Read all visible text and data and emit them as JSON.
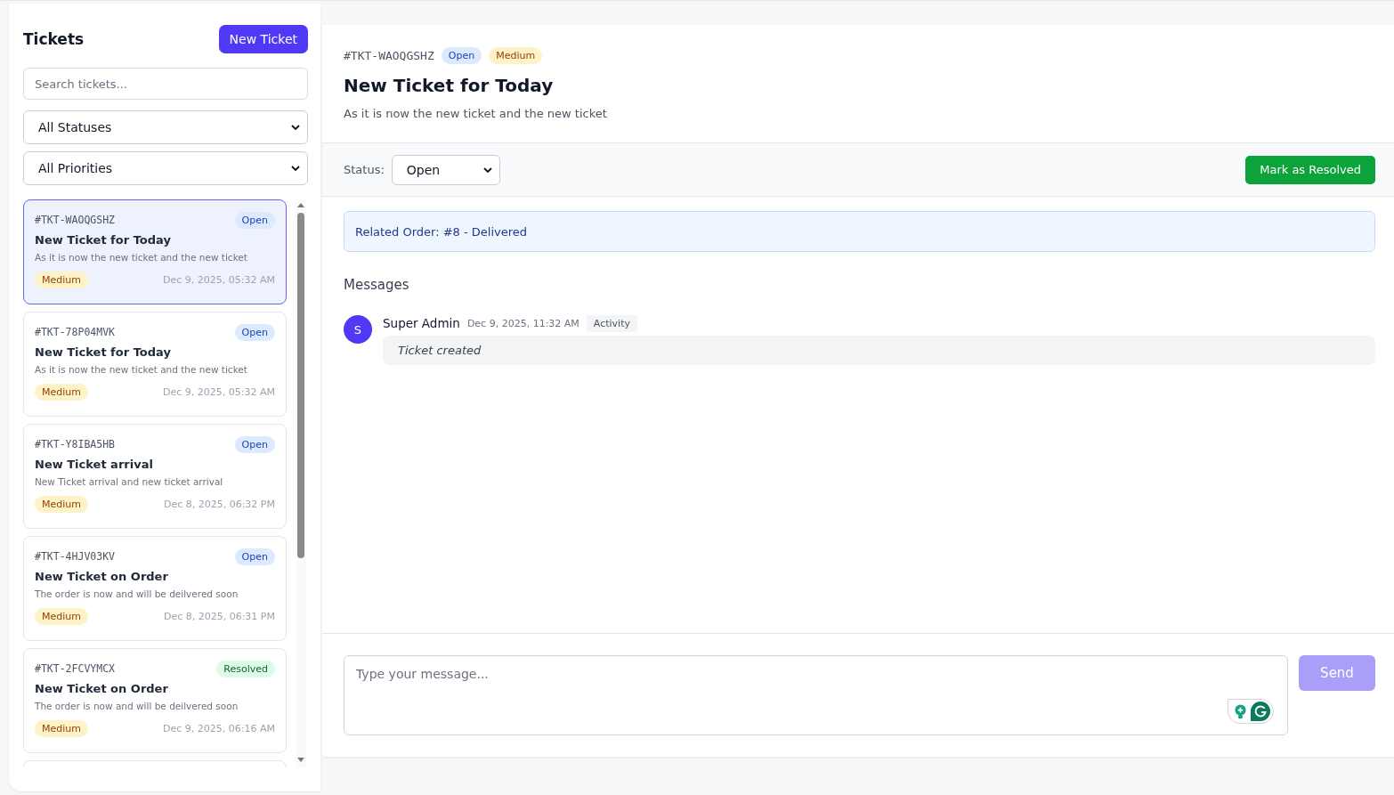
{
  "sidebar": {
    "title": "Tickets",
    "new_button": "New Ticket",
    "search": {
      "placeholder": "Search tickets..."
    },
    "filters": [
      {
        "value": "All Statuses"
      },
      {
        "value": "All Priorities"
      }
    ],
    "tickets": [
      {
        "id": "#TKT-WAOQGSHZ",
        "status": {
          "text": "Open",
          "kind": "open"
        },
        "title": "New Ticket for Today",
        "description": "As it is now the new ticket and the new ticket",
        "priority": "Medium",
        "date": "Dec 9, 2025, 05:32 AM",
        "selected": true
      },
      {
        "id": "#TKT-78P04MVK",
        "status": {
          "text": "Open",
          "kind": "open"
        },
        "title": "New Ticket for Today",
        "description": "As it is now the new ticket and the new ticket",
        "priority": "Medium",
        "date": "Dec 9, 2025, 05:32 AM",
        "selected": false
      },
      {
        "id": "#TKT-Y8IBA5HB",
        "status": {
          "text": "Open",
          "kind": "open"
        },
        "title": "New Ticket arrival",
        "description": "New Ticket arrival and new ticket arrival",
        "priority": "Medium",
        "date": "Dec 8, 2025, 06:32 PM",
        "selected": false
      },
      {
        "id": "#TKT-4HJV03KV",
        "status": {
          "text": "Open",
          "kind": "open"
        },
        "title": "New Ticket on Order",
        "description": "The order is now and will be deilvered soon",
        "priority": "Medium",
        "date": "Dec 8, 2025, 06:31 PM",
        "selected": false
      },
      {
        "id": "#TKT-2FCVYMCX",
        "status": {
          "text": "Resolved",
          "kind": "resolved"
        },
        "title": "New Ticket on Order",
        "description": "The order is now and will be deilvered soon",
        "priority": "Medium",
        "date": "Dec 9, 2025, 06:16 AM",
        "selected": false
      }
    ]
  },
  "detail": {
    "id": "#TKT-WAOQGSHZ",
    "status": {
      "text": "Open",
      "kind": "open"
    },
    "priority": "Medium",
    "title": "New Ticket for Today",
    "description": "As it is now the new ticket and the new ticket",
    "status_label": "Status:",
    "status_value": "Open",
    "resolve_button": "Mark as Resolved",
    "related_order": {
      "label": "Related Order:",
      "value": "#8 - Delivered"
    },
    "messages_title": "Messages",
    "messages": [
      {
        "avatar": "S",
        "author": "Super Admin",
        "time": "Dec 9, 2025, 11:32 AM",
        "tag": "Activity",
        "text": "Ticket created",
        "kind": "activity"
      }
    ],
    "composer": {
      "placeholder": "Type your message...",
      "send": "Send",
      "send_disabled": true
    }
  }
}
